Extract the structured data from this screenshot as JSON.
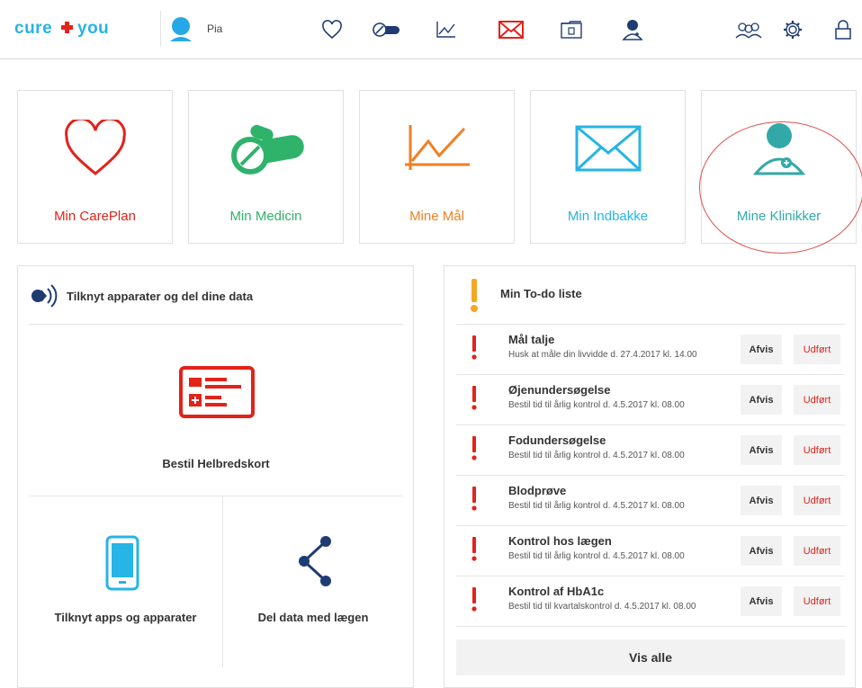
{
  "colors": {
    "red": "#e2231a",
    "green": "#2fb36b",
    "orange": "#f07f24",
    "blue": "#27b4e6",
    "teal": "#33a8a8",
    "navy": "#1e3c72"
  },
  "header": {
    "logo_text": "cure+you",
    "user_name": "Pia",
    "nav_icons": [
      "heart-icon",
      "pills-icon",
      "chart-icon",
      "mail-icon",
      "folder-icon",
      "clinic-icon"
    ],
    "right_icons": [
      "group-icon",
      "gear-icon",
      "lock-icon"
    ]
  },
  "tiles": [
    {
      "label": "Min CarePlan",
      "icon": "heart-icon",
      "color": "#e2231a"
    },
    {
      "label": "Min Medicin",
      "icon": "pills-icon",
      "color": "#2fb36b"
    },
    {
      "label": "Mine Mål",
      "icon": "chart-icon",
      "color": "#f07f24"
    },
    {
      "label": "Min Indbakke",
      "icon": "mail-icon",
      "color": "#27b4e6"
    },
    {
      "label": "Mine Klinikker",
      "icon": "clinic-icon",
      "color": "#33a8a8"
    }
  ],
  "devices": {
    "title": "Tilknyt apparater og del dine data",
    "health_card": "Bestil Helbredskort",
    "connect_apps": "Tilknyt apps og apparater",
    "share_data": "Del data med lægen"
  },
  "todo": {
    "title": "Min To-do liste",
    "afvis_label": "Afvis",
    "udfort_label": "Udført",
    "see_all": "Vis alle",
    "items": [
      {
        "title": "Mål talje",
        "subtitle": "Husk at måle din livvidde d. 27.4.2017 kl. 14.00"
      },
      {
        "title": "Øjenundersøgelse",
        "subtitle": "Bestil tid til årlig kontrol d. 4.5.2017 kl. 08.00"
      },
      {
        "title": "Fodundersøgelse",
        "subtitle": "Bestil tid til årlig kontrol d. 4.5.2017 kl. 08.00"
      },
      {
        "title": "Blodprøve",
        "subtitle": "Bestil tid til årlig kontrol d. 4.5.2017 kl. 08.00"
      },
      {
        "title": "Kontrol hos lægen",
        "subtitle": "Bestil tid til årlig kontrol d. 4.5.2017 kl. 08.00"
      },
      {
        "title": "Kontrol af HbA1c",
        "subtitle": "Bestil tid til kvartalskontrol d. 4.5.2017 kl. 08.00"
      }
    ]
  }
}
